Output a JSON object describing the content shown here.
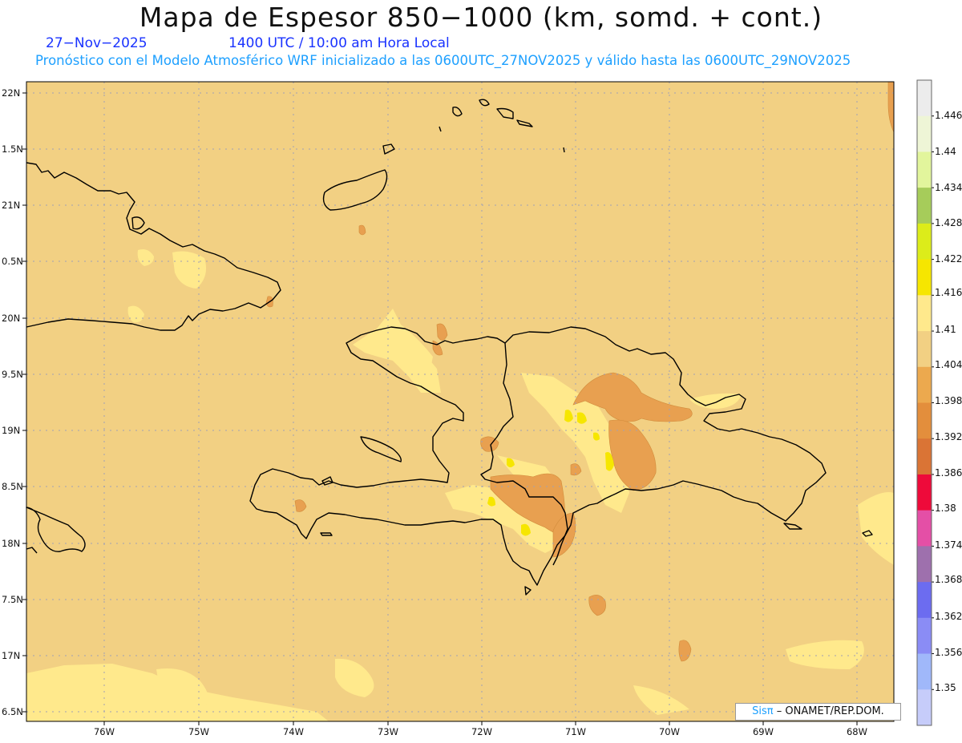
{
  "title": "Mapa de Espesor 850−1000 (km, somd. + cont.)",
  "date": "27−Nov−2025",
  "time": "1400 UTC / 10:00 am Hora Local",
  "forecast_note": "Pronóstico con el Modelo Atmosférico WRF inicializado a las 0600UTC_27NOV2025 y válido hasta las  0600UTC_29NOV2025",
  "lat_labels": [
    "22N",
    "1.5N",
    "21N",
    "0.5N",
    "20N",
    "9.5N",
    "19N",
    "8.5N",
    "18N",
    "7.5N",
    "17N",
    "6.5N"
  ],
  "lon_labels": [
    "76W",
    "75W",
    "74W",
    "73W",
    "72W",
    "71W",
    "70W",
    "69W",
    "68W"
  ],
  "colorbar": {
    "labels": [
      "1.446",
      "1.44",
      "1.434",
      "1.428",
      "1.422",
      "1.416",
      "1.41",
      "1.404",
      "1.398",
      "1.392",
      "1.386",
      "1.38",
      "1.374",
      "1.368",
      "1.362",
      "1.356",
      "1.35"
    ],
    "colors": [
      "#ececec",
      "#eef5d6",
      "#e2f59c",
      "#a6cc5a",
      "#dcec1a",
      "#f6e600",
      "#ffe98c",
      "#f2d083",
      "#eca94e",
      "#e38e3c",
      "#da7435",
      "#ee0a3a",
      "#e44fa6",
      "#9e70ad",
      "#6c6cf0",
      "#8a8cf5",
      "#a0b8fa",
      "#c6ccfa"
    ]
  },
  "credit": {
    "brand": "Sisπ",
    "rest": "– ONAMET/REP.DOM."
  },
  "colors": {
    "background": "#f2d083",
    "light": "#ffe98c",
    "yellow": "#f6e600",
    "orange": "#e8a050",
    "coast": "#000000",
    "grid": "#a0a0b4"
  }
}
